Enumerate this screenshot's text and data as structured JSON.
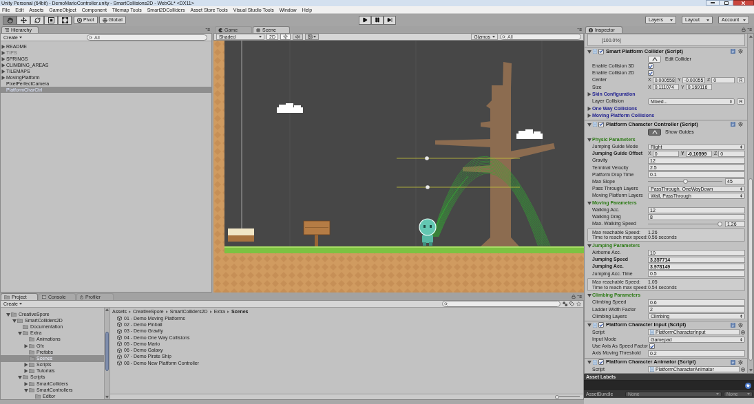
{
  "window": {
    "title": "Unity Personal (64bit) - DemoMarioController.unity - SmartCollisions2D - WebGL* <DX11>"
  },
  "menu": [
    "File",
    "Edit",
    "Assets",
    "GameObject",
    "Component",
    "Tilemap Tools",
    "Smart2DColliders",
    "Asset Store Tools",
    "Visual Studio Tools",
    "Window",
    "Help"
  ],
  "toolbar": {
    "tools": [
      {
        "kind": "hand",
        "selected": true
      },
      {
        "kind": "move",
        "selected": false
      },
      {
        "kind": "rotate",
        "selected": false
      },
      {
        "kind": "scale",
        "selected": false
      },
      {
        "kind": "rect",
        "selected": false
      }
    ],
    "handles": [
      {
        "kind": "pivot",
        "label": "Pivot"
      },
      {
        "kind": "global",
        "label": "Global"
      }
    ],
    "playback": [
      {
        "kind": "play"
      },
      {
        "kind": "pause"
      },
      {
        "kind": "step"
      }
    ],
    "menus": [
      "Layers",
      "Layout",
      "Account"
    ]
  },
  "hierarchy": {
    "tab": "Hierarchy",
    "create": "Create",
    "search": {
      "placeholder": "All"
    },
    "items": [
      {
        "label": "README",
        "expanded": false,
        "active": true,
        "selected": false
      },
      {
        "label": "TIPS",
        "expanded": false,
        "active": false,
        "selected": false
      },
      {
        "label": "SPRINGS",
        "expanded": false,
        "active": true,
        "selected": false
      },
      {
        "label": "CLIMBING_AREAS",
        "expanded": false,
        "active": true,
        "selected": false
      },
      {
        "label": "TILEMAPS",
        "expanded": false,
        "active": true,
        "selected": false
      },
      {
        "label": "MovingPlatform",
        "expanded": false,
        "active": true,
        "selected": false
      },
      {
        "label": "PixelPerfectCamera",
        "active": true,
        "selected": false
      },
      {
        "label": "PlatformCharCtrl",
        "active": true,
        "selected": true
      }
    ]
  },
  "scene_panel": {
    "tabs": [
      {
        "kind": "game",
        "label": "Game",
        "selected": false
      },
      {
        "kind": "scene",
        "label": "Scene",
        "selected": true
      }
    ],
    "shading": "Shaded",
    "toggles": [
      {
        "kind": "dimension",
        "label": "2D",
        "on": true
      },
      {
        "kind": "lighting",
        "on": true
      },
      {
        "kind": "audio",
        "on": false
      },
      {
        "kind": "effects",
        "on": false
      }
    ],
    "gizmos": "Gizmos",
    "search": {
      "placeholder": "All"
    }
  },
  "inspector": {
    "tab": "Inspector",
    "notice": "[100.0%]",
    "components": [
      {
        "title": "Smart Platform Collider (Script)",
        "enabled": true,
        "expanded": true,
        "rows": [
          {
            "kind": "button",
            "label": "Edit Collider",
            "pressed": false
          },
          {
            "kind": "checkbox",
            "label": "Enable Collision 3D",
            "checked": true
          },
          {
            "kind": "checkbox",
            "label": "Enable Collision 2D",
            "checked": true
          },
          {
            "kind": "vector",
            "label": "Center",
            "bold": false,
            "fields": [
              {
                "axis": "X",
                "value": "0.000558",
                "bold": false
              },
              {
                "axis": "Y",
                "value": "-0.00055",
                "bold": false
              },
              {
                "axis": "Z",
                "value": "0",
                "bold": false
              }
            ],
            "reset": "R"
          },
          {
            "kind": "vector",
            "label": "Size",
            "bold": false,
            "fields": [
              {
                "axis": "X",
                "value": "0.111074",
                "bold": false
              },
              {
                "axis": "Y",
                "value": "0.169116",
                "bold": false
              }
            ]
          },
          {
            "kind": "foldout",
            "label": "Skin Configuration",
            "expanded": false,
            "color": "#1f1f8f"
          },
          {
            "kind": "dropdown",
            "label": "Layer Collision",
            "value": "Mixed...",
            "reset": "R"
          },
          {
            "kind": "foldout",
            "label": "One Way Collisions",
            "expanded": false,
            "color": "#1f1f8f"
          },
          {
            "kind": "foldout",
            "label": "Moving Platform Collisions",
            "expanded": false,
            "color": "#1f1f8f"
          }
        ]
      },
      {
        "title": "Platform Character Controller (Script)",
        "enabled": true,
        "expanded": true,
        "rows": [
          {
            "kind": "button",
            "label": "Show Guides",
            "pressed": true
          },
          {
            "kind": "foldout",
            "label": "Physic Parameters",
            "expanded": true,
            "color": "#2d7a16"
          },
          {
            "kind": "dropdown",
            "label": "Jumping Guide Mode",
            "value": "Right"
          },
          {
            "kind": "vector",
            "label": "Jumping Guide Offset",
            "bold": true,
            "fields": [
              {
                "axis": "X",
                "value": "0",
                "bold": false
              },
              {
                "axis": "Y",
                "value": "-0.10599",
                "bold": true
              },
              {
                "axis": "Z",
                "value": "0",
                "bold": false
              }
            ]
          },
          {
            "kind": "text",
            "label": "Gravity",
            "value": "12",
            "bold": false
          },
          {
            "kind": "text",
            "label": "Terminal Velocity",
            "value": "2.5",
            "bold": false
          },
          {
            "kind": "text",
            "label": "Platform Drop Time",
            "value": "0.1",
            "bold": false
          },
          {
            "kind": "slider",
            "label": "Max Slope",
            "level": 0.5,
            "value": "45"
          },
          {
            "kind": "dropdown",
            "label": "Pass Through Layers",
            "value": "PassThrough, OneWayDown"
          },
          {
            "kind": "dropdown",
            "label": "Moving Platform Layers",
            "value": "Wall, PassThrough"
          },
          {
            "kind": "foldout",
            "label": "Moving Parameters",
            "expanded": true,
            "color": "#2d7a16"
          },
          {
            "kind": "text",
            "label": "Walking Acc.",
            "value": "12",
            "bold": false
          },
          {
            "kind": "text",
            "label": "Walking Drag",
            "value": "8",
            "bold": false
          },
          {
            "kind": "slider",
            "label": "Max. Walking Speed",
            "level": 1,
            "value": "1.26"
          },
          {
            "kind": "help",
            "lines": [
              {
                "label": "Max reachable Speed:",
                "value": "1.26"
              },
              {
                "label": "Time to reach max speed:",
                "value": "0.56 seconds"
              }
            ]
          },
          {
            "kind": "foldout",
            "label": "Jumping Parameters",
            "expanded": true,
            "color": "#2d7a16"
          },
          {
            "kind": "text",
            "label": "Airborne Acc.",
            "value": "10",
            "bold": false
          },
          {
            "kind": "text",
            "label": "Jumping Speed",
            "value": "3.357714",
            "bold": true
          },
          {
            "kind": "text",
            "label": "Jumping Acc.",
            "value": "3.978149",
            "bold": true
          },
          {
            "kind": "text",
            "label": "Jumping Acc. Time",
            "value": "0.5",
            "bold": false
          },
          {
            "kind": "help",
            "lines": [
              {
                "label": "Max reachable Speed:",
                "value": "1.05"
              },
              {
                "label": "Time to reach max speed:",
                "value": "0.54 seconds"
              }
            ]
          },
          {
            "kind": "foldout",
            "label": "Climbing Parameters",
            "expanded": true,
            "color": "#2d7a16"
          },
          {
            "kind": "text",
            "label": "Climbing Speed",
            "value": "0.6",
            "bold": false
          },
          {
            "kind": "text",
            "label": "Ladder Width Factor",
            "value": "2",
            "bold": false
          },
          {
            "kind": "dropdown",
            "label": "Climbing Layers",
            "value": "Climbing"
          }
        ]
      },
      {
        "title": "Platform Character Input (Script)",
        "enabled": true,
        "expanded": true,
        "rows": [
          {
            "kind": "object",
            "label": "Script",
            "value": "PlatformCharacterInput"
          },
          {
            "kind": "dropdown",
            "label": "Input Mode",
            "value": "Gamepad"
          },
          {
            "kind": "checkbox",
            "label": "Use Axis As Speed Factor",
            "checked": true
          },
          {
            "kind": "text",
            "label": "Axis Moving Threshold",
            "value": "0.2",
            "bold": false
          }
        ]
      },
      {
        "title": "Platform Character Animator (Script)",
        "enabled": true,
        "expanded": true,
        "rows": [
          {
            "kind": "object",
            "label": "Script",
            "value": "PlatformCharacterAnimator"
          }
        ]
      }
    ],
    "asset_labels": {
      "title": "Asset Labels",
      "bundle_label": "AssetBundle",
      "bundle_values": [
        "None",
        "None"
      ]
    }
  },
  "project": {
    "tabs": [
      {
        "kind": "project",
        "label": "Project",
        "selected": true
      },
      {
        "kind": "console",
        "label": "Console",
        "selected": false
      },
      {
        "kind": "profiler",
        "label": "Profiler",
        "selected": false
      }
    ],
    "create": "Create",
    "folders": [
      {
        "label": "CreativeSpore",
        "expanded": true,
        "selected": false,
        "children": [
          {
            "label": "SmartColliders2D",
            "expanded": true,
            "selected": false,
            "children": [
              {
                "label": "Documentation",
                "selected": false
              },
              {
                "label": "Extra",
                "expanded": true,
                "selected": false,
                "children": [
                  {
                    "label": "Animations",
                    "selected": false
                  },
                  {
                    "label": "Gfx",
                    "expanded": false,
                    "selected": false
                  },
                  {
                    "label": "Prefabs",
                    "selected": false
                  },
                  {
                    "label": "Scenes",
                    "selected": true
                  },
                  {
                    "label": "Scripts",
                    "expanded": false,
                    "selected": false
                  },
                  {
                    "label": "Tutorials",
                    "expanded": false,
                    "selected": false
                  }
                ]
              },
              {
                "label": "Scripts",
                "expanded": true,
                "selected": false,
                "children": [
                  {
                    "label": "SmartColliders",
                    "expanded": false,
                    "selected": false
                  },
                  {
                    "label": "SmartControllers",
                    "expanded": true,
                    "selected": false,
                    "children": [
                      {
                        "label": "Editor",
                        "selected": false
                      }
                    ]
                  }
                ]
              }
            ]
          }
        ]
      }
    ],
    "breadcrumb": [
      "Assets",
      "CreativeSpore",
      "SmartColliders2D",
      "Extra",
      "Scenes"
    ],
    "files": [
      "01 - Demo Moving Platforms",
      "02 - Demo Pinball",
      "03 - Demo Gravity",
      "04 - Demo One Way Collisions",
      "05 - Demo Mario",
      "06 - Demo Galaxy",
      "07 - Demo Pirate Ship",
      "08 - Demo New Platform Controller"
    ],
    "icon_size": {
      "level": 0
    }
  }
}
